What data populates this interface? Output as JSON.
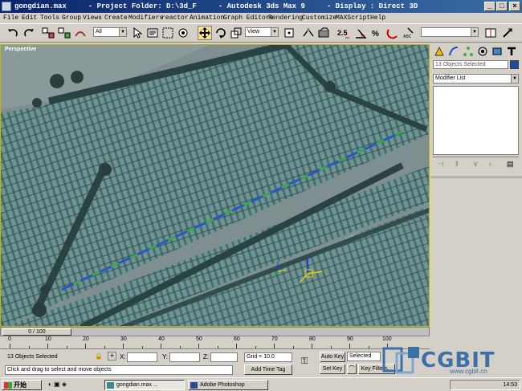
{
  "window": {
    "title": "gongdian.max     - Project Folder: D:\\3d_F     - Autodesk 3ds Max 9     - Display : Direct 3D"
  },
  "menu": [
    "File",
    "Edit",
    "Tools",
    "Group",
    "Views",
    "Create",
    "Modifiers",
    "reactor",
    "Animation",
    "Graph Editors",
    "Rendering",
    "Customize",
    "MAXScript",
    "Help"
  ],
  "toolbar": {
    "selection_filter": "All",
    "ref_coord": "View",
    "named_selection": ""
  },
  "viewport": {
    "label": "Perspective"
  },
  "command_panel": {
    "selection_name": "13 Objects Selected",
    "selection_color": "#1d4aa0",
    "modifier_list": "Modifier List"
  },
  "timeline": {
    "frame_label": "0 / 100",
    "ticks": [
      "0",
      "10",
      "20",
      "30",
      "40",
      "50",
      "60",
      "70",
      "80",
      "90",
      "100"
    ]
  },
  "status": {
    "selection_count": "13 Objects Selected",
    "prompt": "Click and drag to select and move objects",
    "x_label": "X:",
    "y_label": "Y:",
    "z_label": "Z:",
    "x_value": "",
    "y_value": "",
    "z_value": "",
    "grid": "Grid = 10.0",
    "add_time_tag": "Add Time Tag",
    "auto_key": "Auto Key",
    "set_key": "Set Key",
    "key_mode": "Selected",
    "key_filters": "Key Filters..."
  },
  "watermark": {
    "logo_text": "CGBIT",
    "url": "www.cgbit.cn"
  },
  "taskbar": {
    "start": "开始",
    "tasks": [
      "gongdian.max ...",
      "Adobe Photoshop"
    ],
    "clock": "14:53"
  }
}
